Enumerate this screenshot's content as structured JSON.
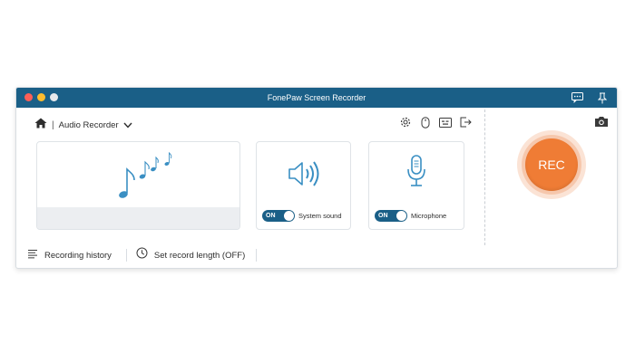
{
  "window": {
    "title": "FonePaw Screen Recorder"
  },
  "toolbar": {
    "mode_label": "Audio Recorder",
    "separator": "|"
  },
  "sources": {
    "system_sound": {
      "toggle": "ON",
      "label": "System sound"
    },
    "microphone": {
      "toggle": "ON",
      "label": "Microphone"
    }
  },
  "rec_button": {
    "label": "REC"
  },
  "footer": {
    "history_label": "Recording history",
    "length_label": "Set record length (OFF)"
  },
  "colors": {
    "titlebar": "#1a5f87",
    "accent": "#3a8fc3",
    "rec": "#ef7c35"
  },
  "icons": {
    "titlebar": [
      "feedback-icon",
      "pin-icon"
    ],
    "toolbar": [
      "home-icon",
      "chevron-down-icon",
      "settings-icon",
      "mouse-icon",
      "hotkey-icon",
      "exit-icon",
      "camera-icon"
    ],
    "cards": [
      "music-notes-icon",
      "speaker-icon",
      "microphone-icon"
    ],
    "footer": [
      "list-icon",
      "clock-icon"
    ]
  }
}
